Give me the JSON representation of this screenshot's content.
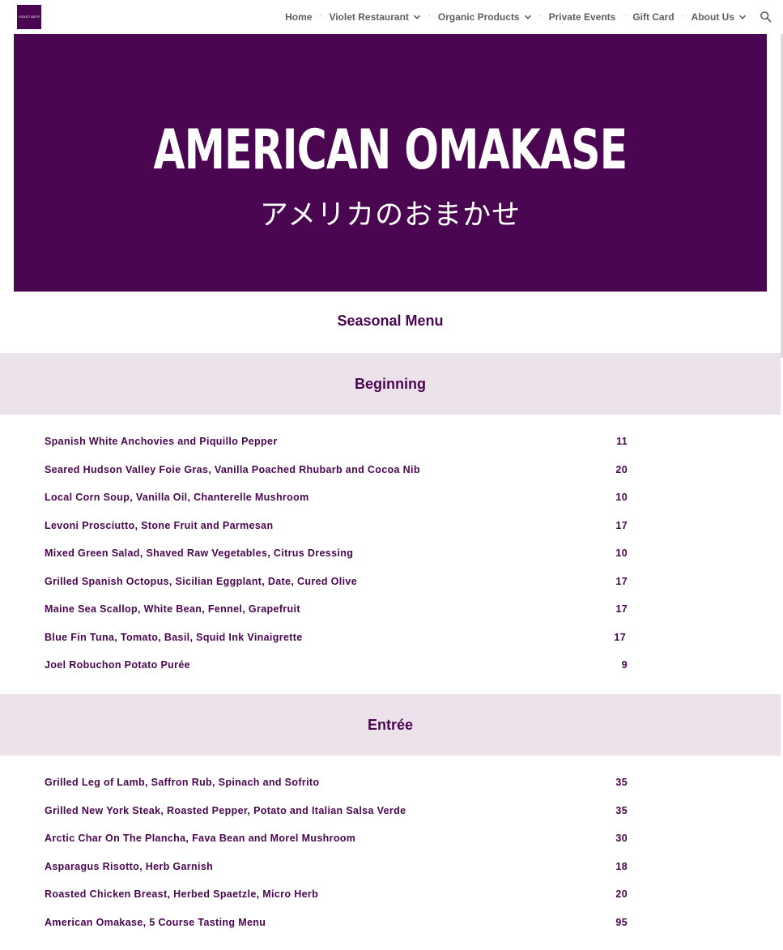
{
  "header": {
    "logo_text": "VIOLET BISTRO",
    "nav": [
      {
        "label": "Home",
        "has_dropdown": false
      },
      {
        "label": "Violet Restaurant",
        "has_dropdown": true
      },
      {
        "label": "Organic Products",
        "has_dropdown": true
      },
      {
        "label": "Private Events",
        "has_dropdown": false
      },
      {
        "label": "Gift Card",
        "has_dropdown": false
      },
      {
        "label": "About Us",
        "has_dropdown": true
      }
    ],
    "search_icon": "search-icon"
  },
  "hero": {
    "title": "AMERICAN OMAKASE",
    "subtitle": "アメリカのおまかせ",
    "background": "#4a0650"
  },
  "menu": {
    "title": "Seasonal Menu",
    "sections": [
      {
        "name": "Beginning",
        "items": [
          {
            "name": "Spanish White Anchovies and Piquillo Pepper",
            "price": "11"
          },
          {
            "name": "Seared Hudson Valley Foie Gras, Vanilla Poached Rhubarb and Cocoa Nib",
            "price": "20"
          },
          {
            "name": "Local Corn Soup, Vanilla Oil, Chanterelle Mushroom",
            "price": "10"
          },
          {
            "name": "Levoni Prosciutto, Stone Fruit and Parmesan",
            "price": "17"
          },
          {
            "name": "Mixed Green Salad, Shaved Raw Vegetables, Citrus Dressing",
            "price": "10"
          },
          {
            "name": "Grilled Spanish Octopus, Sicilian Eggplant, Date, Cured Olive",
            "price": "17"
          },
          {
            "name": "Maine Sea Scallop, White Bean, Fennel, Grapefruit",
            "price": "17"
          },
          {
            "name": "Blue Fin Tuna, Tomato, Basil, Squid Ink Vinaigrette",
            "price": "17"
          },
          {
            "name": "Joel Robuchon Potato Purée",
            "price": "9"
          }
        ]
      },
      {
        "name": "Entrée",
        "items": [
          {
            "name": "Grilled Leg of Lamb, Saffron Rub, Spinach and Sofrito",
            "price": "35"
          },
          {
            "name": "Grilled New York Steak, Roasted Pepper, Potato and Italian Salsa Verde",
            "price": "35"
          },
          {
            "name": "Arctic Char On The Plancha, Fava Bean and Morel Mushroom",
            "price": "30"
          },
          {
            "name": "Asparagus Risotto, Herb Garnish",
            "price": "18"
          },
          {
            "name": "Roasted Chicken Breast, Herbed Spaetzle, Micro Herb",
            "price": "20"
          },
          {
            "name": "American Omakase, 5 Course Tasting Menu",
            "price": "95"
          }
        ]
      }
    ]
  },
  "colors": {
    "brand": "#4a0650",
    "band": "#ebe2ea",
    "nav_text": "#5f5f5f"
  }
}
